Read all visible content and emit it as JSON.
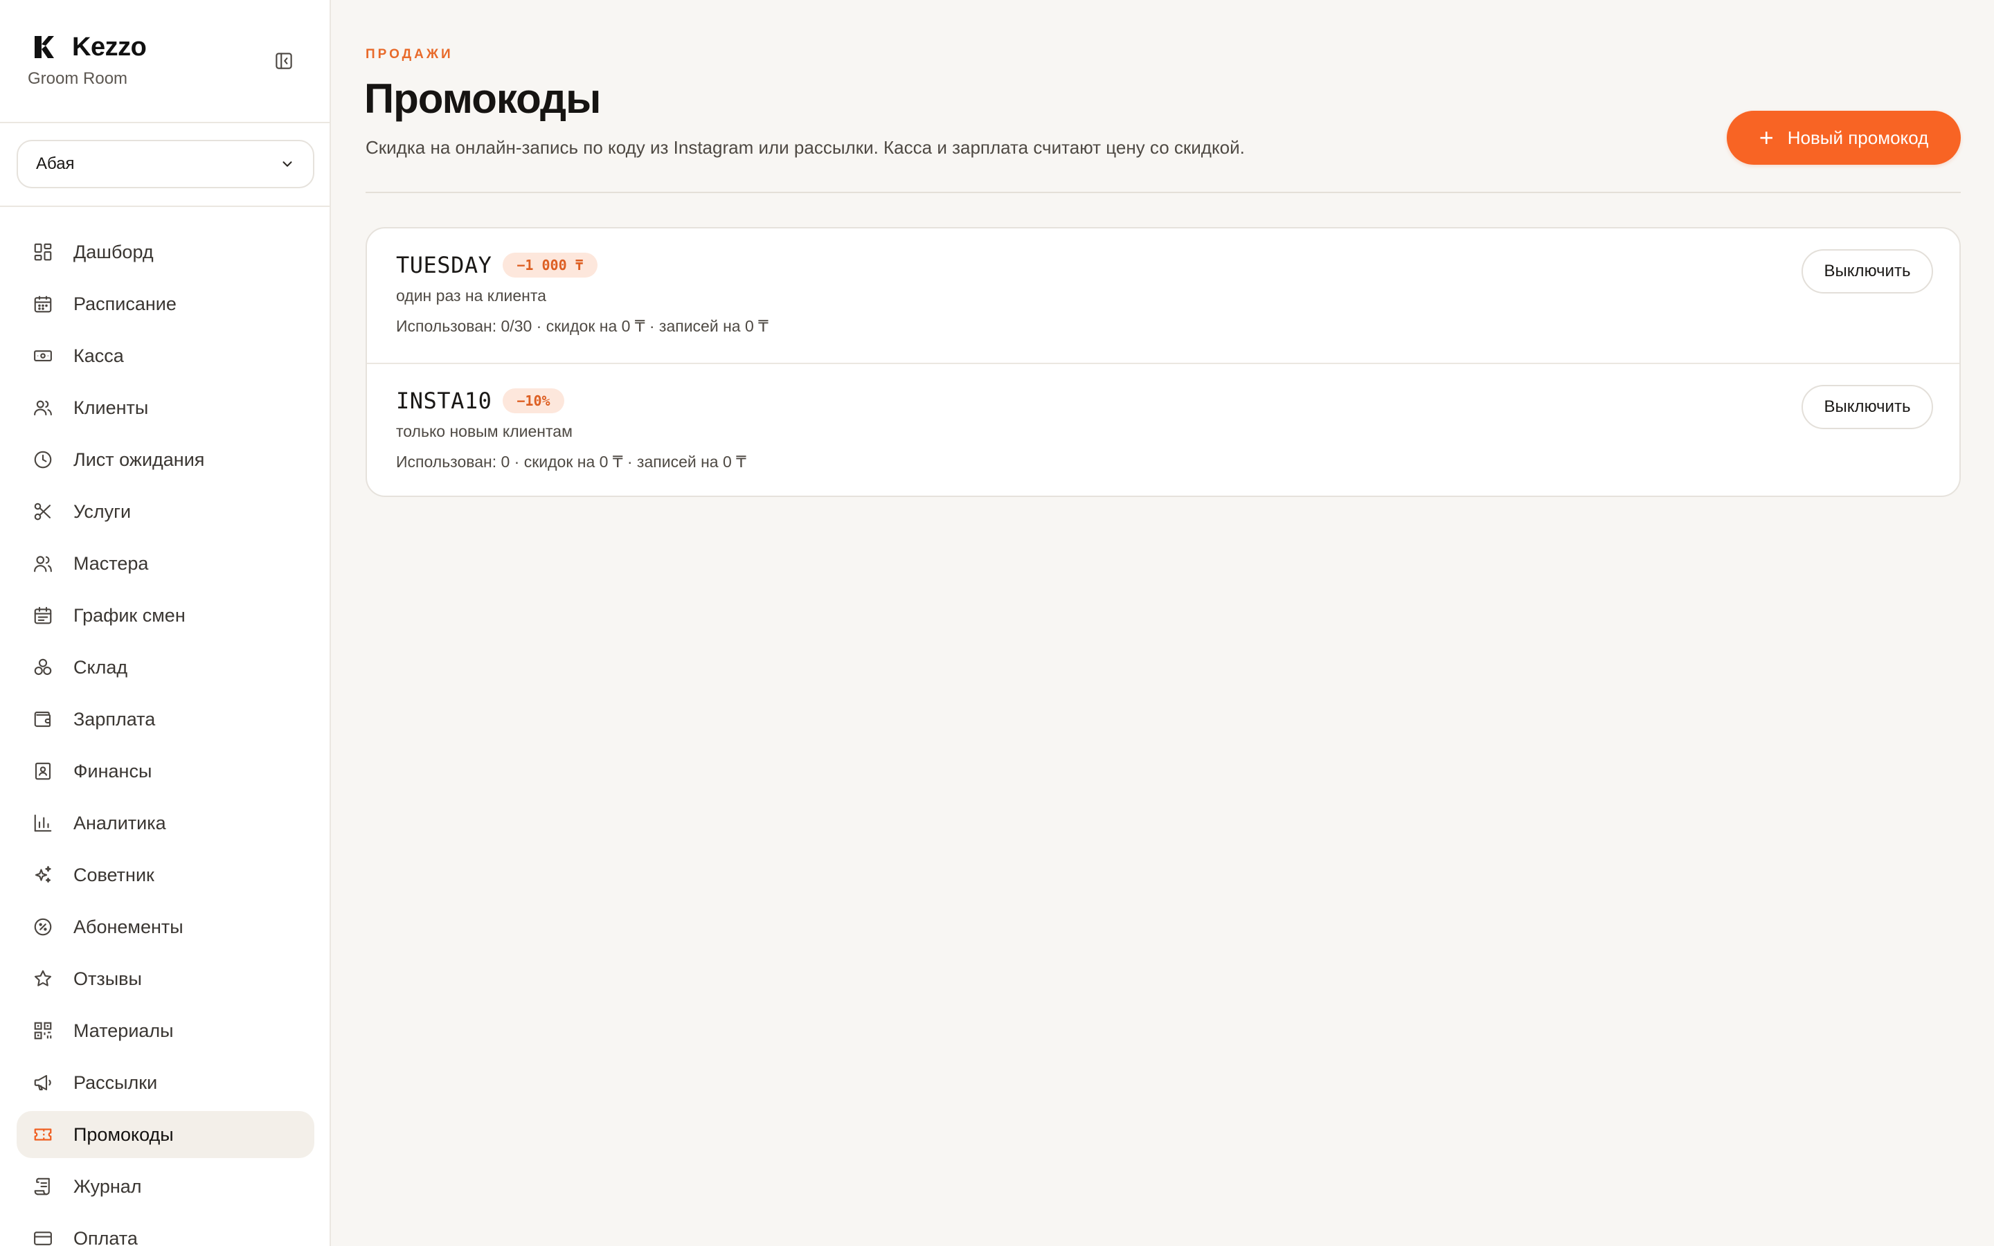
{
  "brand": {
    "name": "Kezzo",
    "subtitle": "Groom Room",
    "logo_icon": "kezzo-logo",
    "collapse_icon": "sidebar-collapse-icon"
  },
  "branch_select": {
    "value": "Абая",
    "icon": "chevron-down-icon"
  },
  "sidebar": {
    "items": [
      {
        "label": "Дашборд",
        "icon": "dashboard-icon",
        "active": false
      },
      {
        "label": "Расписание",
        "icon": "calendar-icon",
        "active": false
      },
      {
        "label": "Касса",
        "icon": "cash-icon",
        "active": false
      },
      {
        "label": "Клиенты",
        "icon": "users-icon",
        "active": false
      },
      {
        "label": "Лист ожидания",
        "icon": "clock-icon",
        "active": false
      },
      {
        "label": "Услуги",
        "icon": "scissors-icon",
        "active": false
      },
      {
        "label": "Мастера",
        "icon": "masters-icon",
        "active": false
      },
      {
        "label": "График смен",
        "icon": "shift-calendar-icon",
        "active": false
      },
      {
        "label": "Склад",
        "icon": "boxes-icon",
        "active": false
      },
      {
        "label": "Зарплата",
        "icon": "wallet-icon",
        "active": false
      },
      {
        "label": "Финансы",
        "icon": "finance-book-icon",
        "active": false
      },
      {
        "label": "Аналитика",
        "icon": "bar-chart-icon",
        "active": false
      },
      {
        "label": "Советник",
        "icon": "sparkles-icon",
        "active": false
      },
      {
        "label": "Абонементы",
        "icon": "percent-badge-icon",
        "active": false
      },
      {
        "label": "Отзывы",
        "icon": "star-icon",
        "active": false
      },
      {
        "label": "Материалы",
        "icon": "qr-code-icon",
        "active": false
      },
      {
        "label": "Рассылки",
        "icon": "megaphone-icon",
        "active": false
      },
      {
        "label": "Промокоды",
        "icon": "ticket-icon",
        "active": true
      },
      {
        "label": "Журнал",
        "icon": "scroll-icon",
        "active": false
      },
      {
        "label": "Оплата",
        "icon": "credit-card-icon",
        "active": false
      }
    ]
  },
  "header": {
    "eyebrow": "ПРОДАЖИ",
    "title": "Промокоды",
    "description": "Скидка на онлайн-запись по коду из Instagram или рассылки. Касса и зарплата считают цену со скидкой.",
    "new_button_label": "Новый промокод",
    "new_button_icon": "plus-icon"
  },
  "promos": [
    {
      "code": "TUESDAY",
      "badge": "−1 000 ₸",
      "condition": "один раз на клиента",
      "stats": "Использован: 0/30 · скидок на 0 ₸ · записей на 0 ₸",
      "action_label": "Выключить"
    },
    {
      "code": "INSTA10",
      "badge": "−10%",
      "condition": "только новым клиентам",
      "stats": "Использован: 0 · скидок на 0 ₸ · записей на 0 ₸",
      "action_label": "Выключить"
    }
  ],
  "colors": {
    "accent": "#f86424",
    "accent_text": "#e86a2a",
    "background": "#f8f6f3",
    "active_nav_bg": "#f3efe9",
    "badge_bg": "#fde7dc"
  }
}
